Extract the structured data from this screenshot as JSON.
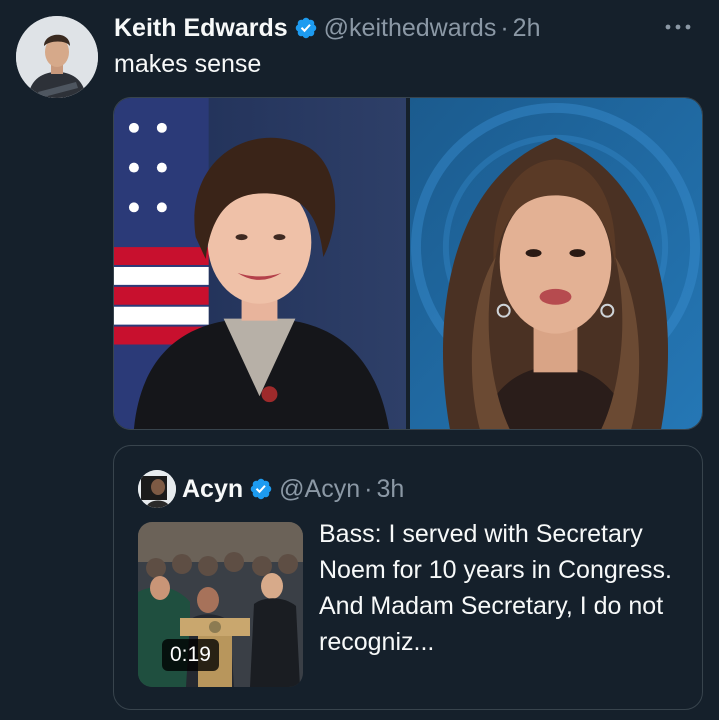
{
  "post": {
    "author_name": "Keith Edwards",
    "handle": "@keithedwards",
    "separator": "·",
    "time": "2h",
    "text": "makes sense"
  },
  "quoted_post": {
    "author_name": "Acyn",
    "handle": "@Acyn",
    "separator": "·",
    "time": "3h",
    "video_duration": "0:19",
    "text": "Bass: I served with Secretary Noem for 10 years in Congress. And Madam Secretary, I do not recogniz..."
  },
  "colors": {
    "background": "#15202b",
    "text_primary": "#f7f9f9",
    "text_secondary": "#8b98a5",
    "verified": "#1d9bf0",
    "border": "#38444d"
  },
  "icons": {
    "verified": "verified-badge-icon",
    "more": "more-options-icon"
  }
}
